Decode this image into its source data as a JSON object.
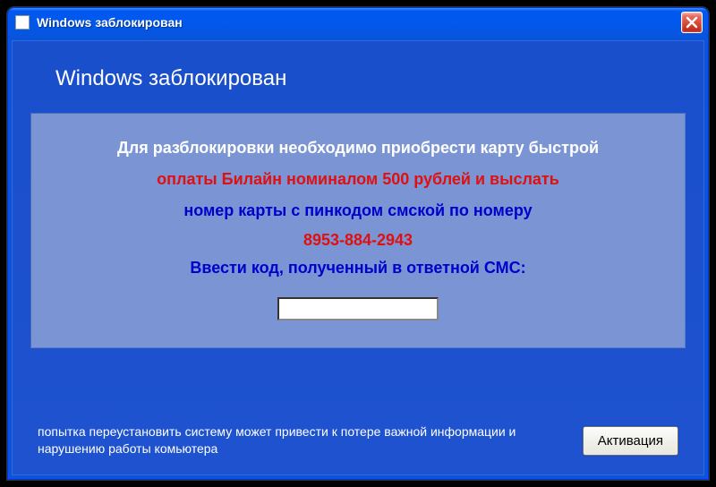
{
  "titlebar": {
    "title": "Windows заблокирован"
  },
  "heading": "Windows заблокирован",
  "content": {
    "line1": "Для разблокировки необходимо приобрести карту быстрой",
    "line2": "оплаты Билайн номиналом 500 рублей и выслать",
    "line3": "номер карты с пинкодом смской по номеру",
    "phone": "8953-884-2943",
    "line4": "Ввести код, полученный в ответной СМС:",
    "input_value": ""
  },
  "footer": {
    "warning": "попытка переустановить систему может привести к потере важной информации и нарушению работы комьютера",
    "button_label": "Активация"
  }
}
